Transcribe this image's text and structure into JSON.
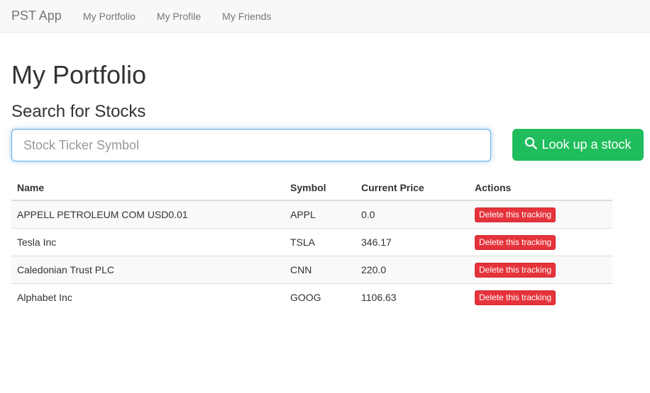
{
  "navbar": {
    "brand": "PST App",
    "links": [
      "My Portfolio",
      "My Profile",
      "My Friends"
    ]
  },
  "page_title": "My Portfolio",
  "search": {
    "heading": "Search for Stocks",
    "placeholder": "Stock Ticker Symbol",
    "value": "",
    "button_label": "Look up a stock",
    "button_icon": "search-icon",
    "button_color": "#1fbd5c"
  },
  "table": {
    "headers": [
      "Name",
      "Symbol",
      "Current Price",
      "Actions"
    ],
    "rows": [
      {
        "name": "APPELL PETROLEUM COM USD0.01",
        "symbol": "APPL",
        "price": "0.0",
        "action": "Delete this tracking"
      },
      {
        "name": "Tesla Inc",
        "symbol": "TSLA",
        "price": "346.17",
        "action": "Delete this tracking"
      },
      {
        "name": "Caledonian Trust PLC",
        "symbol": "CNN",
        "price": "220.0",
        "action": "Delete this tracking"
      },
      {
        "name": "Alphabet Inc",
        "symbol": "GOOG",
        "price": "1106.63",
        "action": "Delete this tracking"
      }
    ],
    "delete_color": "#e5333b"
  }
}
